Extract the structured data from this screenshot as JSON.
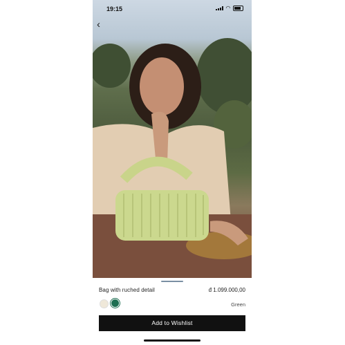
{
  "status_bar": {
    "time": "19:15"
  },
  "navigation": {
    "back_icon": "chevron-left-icon"
  },
  "product": {
    "name": "Bag with ruched detail",
    "price": "đ 1.099.000,00",
    "selected_color": "Green",
    "swatches": [
      {
        "name": "cream",
        "hex": "#efe8d9"
      },
      {
        "name": "green",
        "hex": "#1e6f52"
      }
    ]
  },
  "actions": {
    "wishlist_label": "Add to Wishlist"
  }
}
